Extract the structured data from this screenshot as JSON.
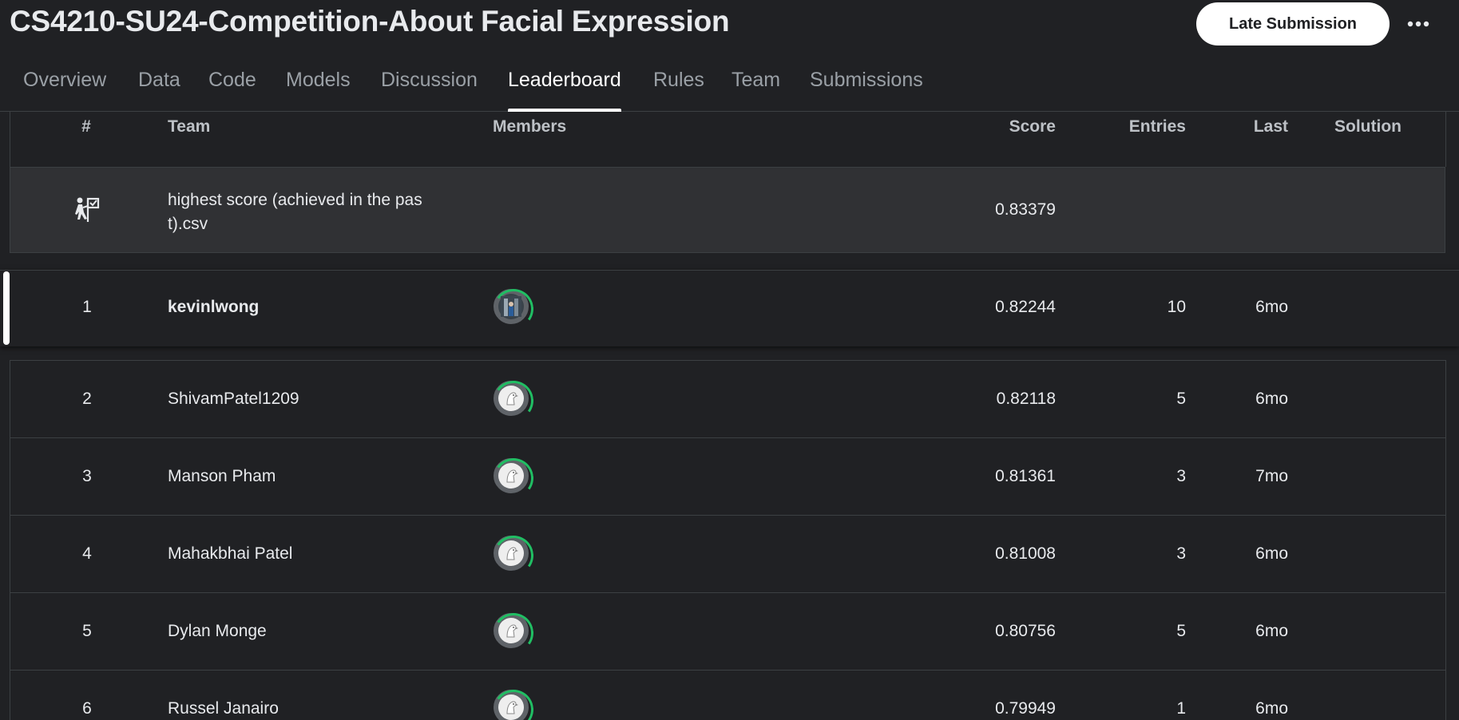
{
  "header": {
    "title": "CS4210-SU24-Competition-About Facial Expression",
    "late_submission_label": "Late Submission",
    "more_label": "•••"
  },
  "tabs": [
    {
      "label": "Overview",
      "active": false
    },
    {
      "label": "Data",
      "active": false
    },
    {
      "label": "Code",
      "active": false
    },
    {
      "label": "Models",
      "active": false
    },
    {
      "label": "Discussion",
      "active": false
    },
    {
      "label": "Leaderboard",
      "active": true
    },
    {
      "label": "Rules",
      "active": false
    },
    {
      "label": "Team",
      "active": false
    },
    {
      "label": "Submissions",
      "active": false
    }
  ],
  "table": {
    "columns": {
      "rank": "#",
      "team": "Team",
      "members": "Members",
      "score": "Score",
      "entries": "Entries",
      "last": "Last",
      "solution": "Solution"
    },
    "benchmark": {
      "icon": "benchmark-icon",
      "team_line1": "highest score (achieved in the pas",
      "team_line2": "t).csv",
      "score": "0.83379"
    },
    "rows": [
      {
        "rank": "1",
        "team": "kevinlwong",
        "score": "0.82244",
        "entries": "10",
        "last": "6mo",
        "avatar": "photo-avatar",
        "selected": true
      },
      {
        "rank": "2",
        "team": "ShivamPatel1209",
        "score": "0.82118",
        "entries": "5",
        "last": "6mo",
        "avatar": "default-goose-avatar",
        "selected": false
      },
      {
        "rank": "3",
        "team": "Manson Pham",
        "score": "0.81361",
        "entries": "3",
        "last": "7mo",
        "avatar": "default-goose-avatar",
        "selected": false
      },
      {
        "rank": "4",
        "team": "Mahakbhai Patel",
        "score": "0.81008",
        "entries": "3",
        "last": "6mo",
        "avatar": "default-goose-avatar",
        "selected": false
      },
      {
        "rank": "5",
        "team": "Dylan Monge",
        "score": "0.80756",
        "entries": "5",
        "last": "6mo",
        "avatar": "default-goose-avatar",
        "selected": false
      },
      {
        "rank": "6",
        "team": "Russel Janairo",
        "score": "0.79949",
        "entries": "1",
        "last": "6mo",
        "avatar": "default-goose-avatar",
        "selected": false
      }
    ]
  },
  "colors": {
    "background": "#202124",
    "benchmark_row": "#303134",
    "avatar_ring": "#20be63",
    "text": "#e8eaed",
    "muted": "#9aa0a6"
  }
}
